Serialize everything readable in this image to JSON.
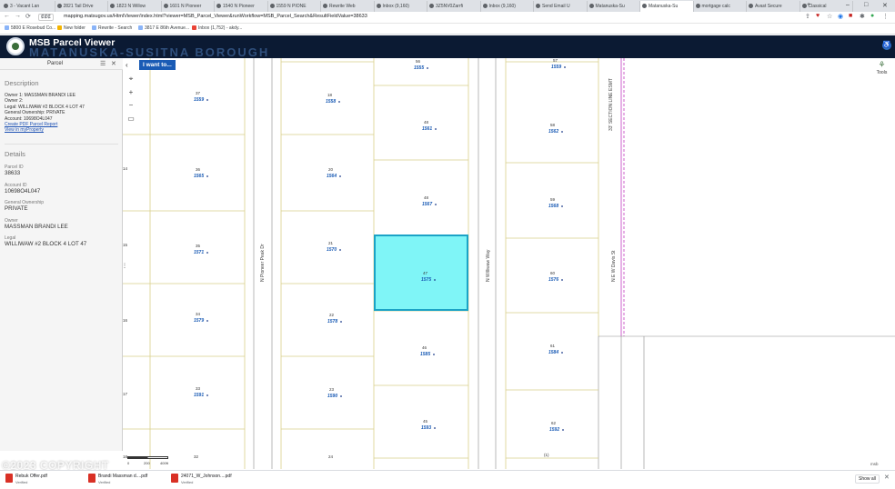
{
  "browser": {
    "tabs": [
      {
        "label": "3 - Vacant Lan"
      },
      {
        "label": "2821 Tail Drive"
      },
      {
        "label": "1823 N Willow"
      },
      {
        "label": "1601 N Pioneer"
      },
      {
        "label": "1540 N Pioneer"
      },
      {
        "label": "1559 N PIONE"
      },
      {
        "label": "Rewrite Web"
      },
      {
        "label": "Inbox (9,160)"
      },
      {
        "label": "3Z5NV0Zarrfi"
      },
      {
        "label": "Inbox (9,160)"
      },
      {
        "label": "Send Email U"
      },
      {
        "label": "Matanuska-Su"
      },
      {
        "label": "Matanuska-Su"
      },
      {
        "label": "mortgage calc"
      },
      {
        "label": "Avast Secure"
      },
      {
        "label": "Classical"
      }
    ],
    "url": "mapping.matsugov.us/HtmlViewer/index.html?viewer=MSB_Parcel_Viewer&runWorkflow=MSB_Parcel_Search&ResultFieldValue=38633",
    "url_security": "₡₡₡",
    "bookmarks": [
      "5800 E Rosebud Co...",
      "New folder",
      "Rewrite - Search",
      "3817 E 86th Avenue...",
      "Inbox (1,752) - akdy..."
    ]
  },
  "app": {
    "title": "MSB Parcel Viewer",
    "subtitle_watermark": "MATANUSKA-SUSITNA BOROUGH",
    "i_want_to": "I want to..."
  },
  "panel": {
    "title": "Parcel",
    "description_heading": "Description",
    "description_lines": [
      {
        "text": "Owner 1: MASSMAN BRANDI LEE",
        "link": false
      },
      {
        "text": "Owner 2:",
        "link": false
      },
      {
        "text": "Legal: WILLIWAW #2           BLOCK 4 LOT 47",
        "link": false
      },
      {
        "text": "General Ownership: PRIVATE",
        "link": false
      },
      {
        "text": "Account: 10698O4L047",
        "link": false
      },
      {
        "text": "Create PDF Parcel Report",
        "link": true
      },
      {
        "text": "View in myProperty",
        "link": true
      }
    ],
    "details_heading": "Details",
    "details": [
      {
        "label": "Parcel ID",
        "value": "38633"
      },
      {
        "label": "Account ID",
        "value": "10698O4L047"
      },
      {
        "label": "General Ownership",
        "value": "PRIVATE"
      },
      {
        "label": "Owner",
        "value": "MASSMAN BRANDI LEE"
      },
      {
        "label": "Legal",
        "value": "WILLIWAW #2 BLOCK 4 LOT 47"
      }
    ]
  },
  "map": {
    "tools_label": "Tools",
    "scale_labels": [
      "0",
      "200",
      "400ft"
    ],
    "attribution": "msb",
    "streets": [
      "N Pioneer Peak Dr",
      "N Williwaw Way",
      "N E W Davis St",
      "33' SECTION LINE ESMT"
    ],
    "parcels": [
      {
        "lot": "56",
        "addr": "1555"
      },
      {
        "lot": "57",
        "addr": "1559"
      },
      {
        "lot": "37",
        "addr": "1559"
      },
      {
        "lot": "18",
        "addr": "1558"
      },
      {
        "lot": "48",
        "addr": "1561"
      },
      {
        "lot": "58",
        "addr": "1562"
      },
      {
        "lot": "36",
        "addr": "1565"
      },
      {
        "lot": "20",
        "addr": "1564"
      },
      {
        "lot": "48",
        "addr": "1567"
      },
      {
        "lot": "59",
        "addr": "1568"
      },
      {
        "lot": "35",
        "addr": "1571"
      },
      {
        "lot": "21",
        "addr": "1570"
      },
      {
        "lot": "47",
        "addr": "1575"
      },
      {
        "lot": "60",
        "addr": "1576"
      },
      {
        "lot": "34",
        "addr": "1579"
      },
      {
        "lot": "22",
        "addr": "1578"
      },
      {
        "lot": "46",
        "addr": "1585"
      },
      {
        "lot": "61",
        "addr": "1584"
      },
      {
        "lot": "33",
        "addr": "1591"
      },
      {
        "lot": "23",
        "addr": "1590"
      },
      {
        "lot": "45",
        "addr": "1593"
      },
      {
        "lot": "62",
        "addr": "1592"
      },
      {
        "lot": "24",
        "addr": ""
      },
      {
        "lot": "32",
        "addr": ""
      },
      {
        "lot": "(1)",
        "addr": ""
      }
    ],
    "block_numbers": [
      "14",
      "15",
      "16",
      "17",
      "18"
    ]
  },
  "downloads": [
    {
      "name": "Rebuk Offer.pdf",
      "status": "Verified"
    },
    {
      "name": "Brandi Massman d....pdf",
      "status": "Verified"
    },
    {
      "name": "24071_W_Johnson....pdf",
      "status": "Verified"
    }
  ],
  "downloads_show_all": "Show all",
  "watermark": "©2023 COPYRIGHT",
  "colors": {
    "header": "#0b1a33",
    "selected_parcel": "#7ff5f7",
    "selected_border": "#1ba3c6",
    "parcel_line": "#d9cf8a",
    "road_line": "#8a8a8a",
    "section_line": "#c03bbf",
    "link": "#1a4fb3"
  }
}
